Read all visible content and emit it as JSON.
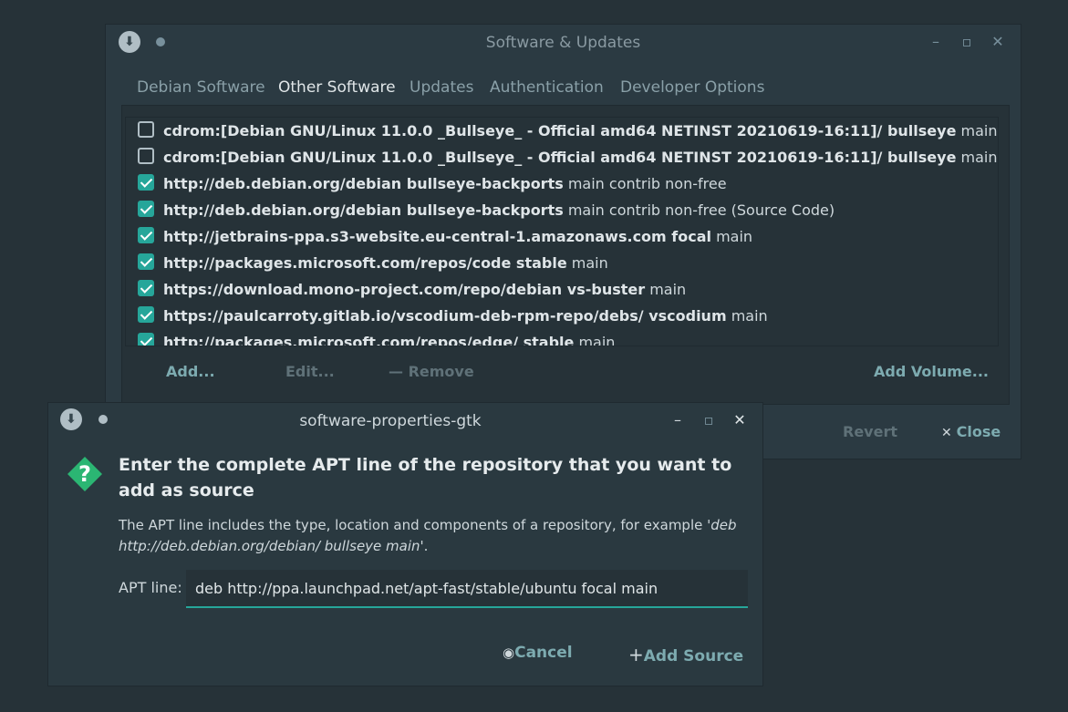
{
  "main_window": {
    "title": "Software & Updates",
    "tabs": [
      "Debian Software",
      "Other Software",
      "Updates",
      "Authentication",
      "Developer Options"
    ],
    "active_tab": "Other Software",
    "sources": [
      {
        "checked": false,
        "bold": "cdrom:[Debian GNU/Linux 11.0.0 _Bullseye_ - Official amd64 NETINST 20210619-16:11]/ bullseye",
        "rest": " main"
      },
      {
        "checked": false,
        "bold": "cdrom:[Debian GNU/Linux 11.0.0 _Bullseye_ - Official amd64 NETINST 20210619-16:11]/ bullseye",
        "rest": " main"
      },
      {
        "checked": true,
        "bold": "http://deb.debian.org/debian bullseye-backports",
        "rest": " main contrib non-free"
      },
      {
        "checked": true,
        "bold": "http://deb.debian.org/debian bullseye-backports",
        "rest": " main contrib non-free (Source Code)"
      },
      {
        "checked": true,
        "bold": "http://jetbrains-ppa.s3-website.eu-central-1.amazonaws.com focal",
        "rest": " main"
      },
      {
        "checked": true,
        "bold": "http://packages.microsoft.com/repos/code stable",
        "rest": " main"
      },
      {
        "checked": true,
        "bold": "https://download.mono-project.com/repo/debian vs-buster",
        "rest": " main"
      },
      {
        "checked": true,
        "bold": "https://paulcarroty.gitlab.io/vscodium-deb-rpm-repo/debs/ vscodium",
        "rest": " main"
      },
      {
        "checked": true,
        "bold": "http://packages.microsoft.com/repos/edge/ stable",
        "rest": " main"
      }
    ],
    "toolbar": {
      "add": "Add...",
      "edit": "Edit...",
      "remove": "Remove",
      "add_volume": "Add Volume..."
    },
    "revert": "Revert",
    "close": "Close"
  },
  "dialog": {
    "title": "software-properties-gtk",
    "heading": "Enter the complete APT line of the repository that you want to add as source",
    "desc_prefix": "The APT line includes the type, location and components of a repository, for example  '",
    "desc_example": "deb http://deb.debian.org/debian/ bullseye main",
    "desc_suffix": "'.",
    "apt_label": "APT line:",
    "apt_value": "deb http://ppa.launchpad.net/apt-fast/stable/ubuntu focal main",
    "cancel": "Cancel",
    "add_source": "Add Source"
  },
  "colors": {
    "background": "#263238",
    "accent": "#26a69a",
    "button_text": "#7dabb0",
    "question_icon": "#2bb673"
  }
}
